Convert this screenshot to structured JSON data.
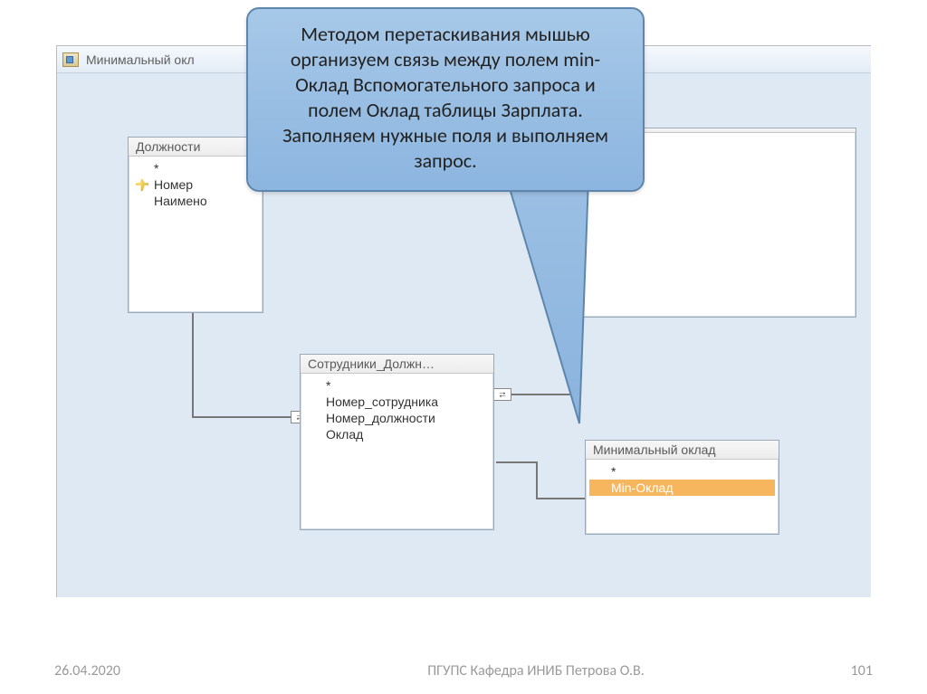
{
  "window": {
    "tab_title": "Минимальный окл"
  },
  "tables": {
    "box1": {
      "title": "Должности",
      "fields": [
        "*",
        "Номер",
        "Наимено"
      ]
    },
    "box2": {
      "title": "",
      "fields": []
    },
    "box3": {
      "title": "Сотрудники_Должн…",
      "fields": [
        "*",
        "Номер_сотрудника",
        "Номер_должности",
        "Оклад"
      ]
    },
    "box4": {
      "title": "Минимальный оклад",
      "fields": [
        "*",
        "Min-Оклад"
      ],
      "selected_index": 1
    }
  },
  "callout": {
    "text": "Методом перетаскивания мышью организуем связь между полем min-Оклад Вспомогательного запроса и полем Оклад таблицы Зарплата. Заполняем нужные поля и выполняем запрос."
  },
  "footer": {
    "date": "26.04.2020",
    "center": "ПГУПС   Кафедра   ИНИБ   Петрова О.В.",
    "page": "101"
  }
}
